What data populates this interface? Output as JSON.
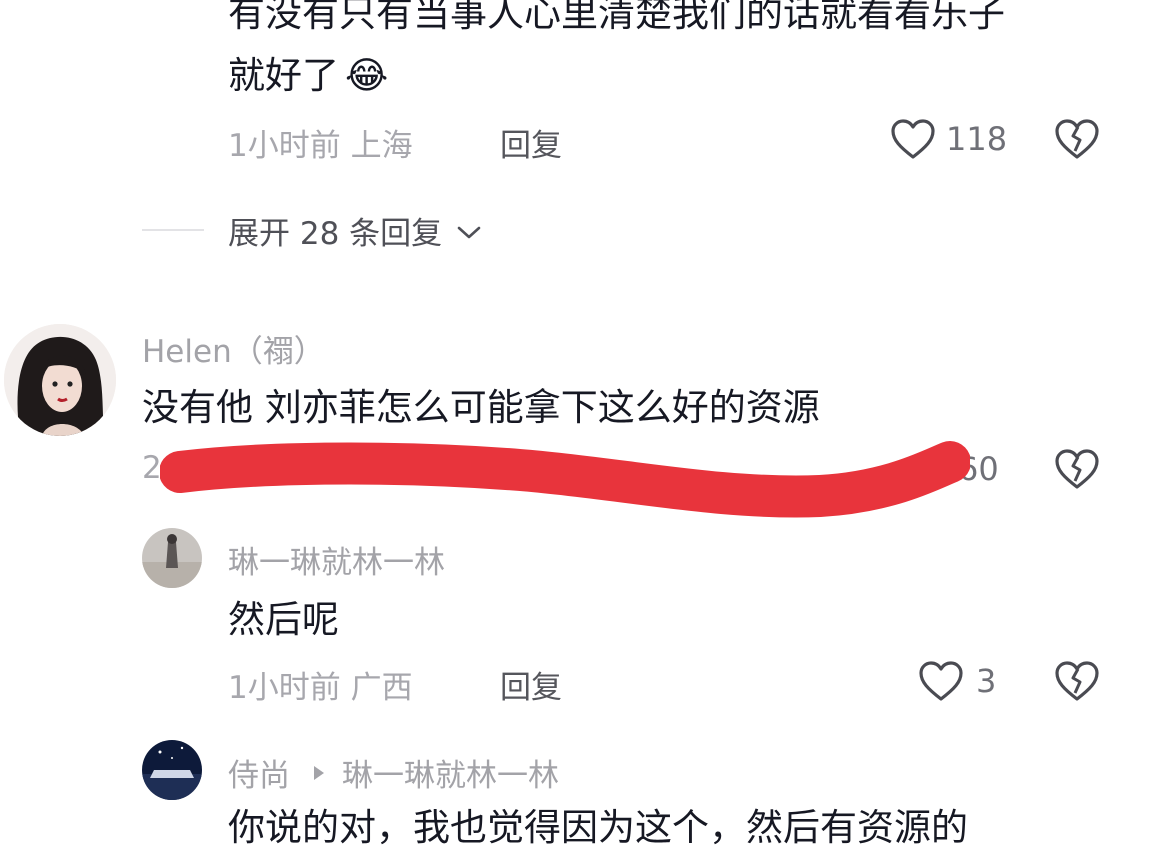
{
  "comment1": {
    "text_line1": "有没有只有当事人心里清楚我们的话就看看乐子",
    "text_line2": "就好了",
    "emoji": "😂",
    "time_location": "1小时前 上海",
    "reply_label": "回复",
    "like_count": "118"
  },
  "expand": {
    "label": "展开 28 条回复"
  },
  "comment2": {
    "username": "Helen（禤）",
    "text": "没有他  刘亦菲怎么可能拿下这么好的资源",
    "time_partial": "2",
    "like_count_partial": "60"
  },
  "reply1": {
    "username": "琳一琳就林一林",
    "text": "然后呢",
    "time_location": "1小时前 广西",
    "reply_label": "回复",
    "like_count": "3"
  },
  "reply2": {
    "username": "侍尚",
    "reply_to": "琳一琳就林一林",
    "text": "你说的对，我也觉得因为这个，然后有资源的"
  },
  "colors": {
    "redaction": "#e8343c"
  }
}
